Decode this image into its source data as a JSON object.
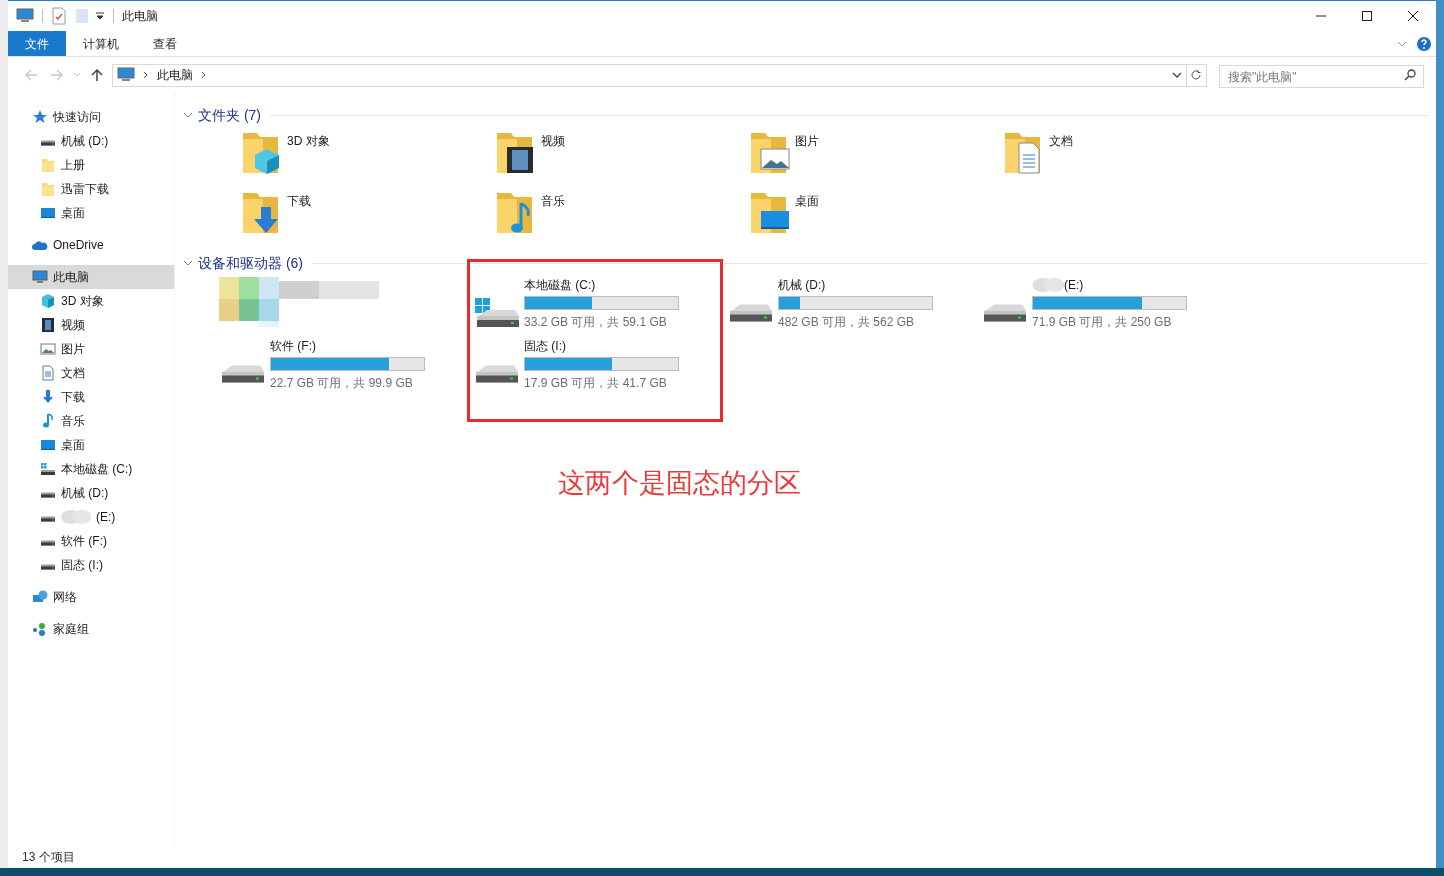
{
  "window": {
    "title": "此电脑"
  },
  "ribbon_tabs": [
    {
      "label": "文件",
      "selected": true
    },
    {
      "label": "计算机",
      "selected": false
    },
    {
      "label": "查看",
      "selected": false
    }
  ],
  "address": {
    "path": [
      "此电脑"
    ]
  },
  "search": {
    "placeholder": "搜索\"此电脑\""
  },
  "sidebar": {
    "items": [
      {
        "label": "快速访问",
        "kind": "star",
        "selected": false,
        "children": [
          {
            "label": "机械 (D:)",
            "kind": "drive",
            "selected": false
          },
          {
            "label": "上册",
            "kind": "folder",
            "selected": false
          },
          {
            "label": "迅雷下载",
            "kind": "folder",
            "selected": false
          },
          {
            "label": "桌面",
            "kind": "desktop",
            "selected": false
          }
        ]
      },
      {
        "label": "OneDrive",
        "kind": "cloud",
        "selected": false
      },
      {
        "label": "此电脑",
        "kind": "pc",
        "selected": true,
        "children": [
          {
            "label": "3D 对象",
            "kind": "cube",
            "selected": false
          },
          {
            "label": "视频",
            "kind": "film",
            "selected": false
          },
          {
            "label": "图片",
            "kind": "image",
            "selected": false
          },
          {
            "label": "文档",
            "kind": "doc",
            "selected": false
          },
          {
            "label": "下载",
            "kind": "download",
            "selected": false
          },
          {
            "label": "音乐",
            "kind": "music",
            "selected": false
          },
          {
            "label": "桌面",
            "kind": "desktop",
            "selected": false
          },
          {
            "label": "本地磁盘 (C:)",
            "kind": "sysdrive",
            "selected": false
          },
          {
            "label": "机械 (D:)",
            "kind": "drive",
            "selected": false
          },
          {
            "label": "(E:)",
            "kind": "drive",
            "selected": false,
            "blurred": true
          },
          {
            "label": "软件 (F:)",
            "kind": "drive",
            "selected": false
          },
          {
            "label": "固态 (I:)",
            "kind": "drive",
            "selected": false
          }
        ]
      },
      {
        "label": "网络",
        "kind": "network",
        "selected": false
      },
      {
        "label": "家庭组",
        "kind": "homegroup",
        "selected": false
      }
    ]
  },
  "folders": {
    "title": "文件夹 (7)",
    "expanded": true,
    "items": [
      {
        "name": "3D 对象",
        "kind": "cube"
      },
      {
        "name": "视频",
        "kind": "film"
      },
      {
        "name": "图片",
        "kind": "image"
      },
      {
        "name": "文档",
        "kind": "doc"
      },
      {
        "name": "下载",
        "kind": "download"
      },
      {
        "name": "音乐",
        "kind": "music"
      },
      {
        "name": "桌面",
        "kind": "desktop"
      }
    ]
  },
  "devices": {
    "title": "设备和驱动器 (6)",
    "expanded": true,
    "items": [
      {
        "kind": "blurred"
      },
      {
        "kind": "system",
        "name": "本地磁盘 (C:)",
        "level": 0.44,
        "reading": "33.2 GB 可用，共 59.1 GB"
      },
      {
        "kind": "drive",
        "name": "机械 (D:)",
        "level": 0.14,
        "reading": "482 GB 可用，共 562 GB"
      },
      {
        "kind": "drive",
        "name": "(E:)",
        "blurred": true,
        "level": 0.71,
        "reading": "71.9 GB 可用，共 250 GB"
      },
      {
        "kind": "drive",
        "name": "软件 (F:)",
        "level": 0.77,
        "reading": "22.7 GB 可用，共 99.9 GB"
      },
      {
        "kind": "drive",
        "name": "固态 (I:)",
        "level": 0.57,
        "reading": "17.9 GB 可用，共 41.7 GB"
      }
    ]
  },
  "annotation": {
    "text": "这两个是固态的分区"
  },
  "status_bar": {
    "text": "13 个项目"
  }
}
